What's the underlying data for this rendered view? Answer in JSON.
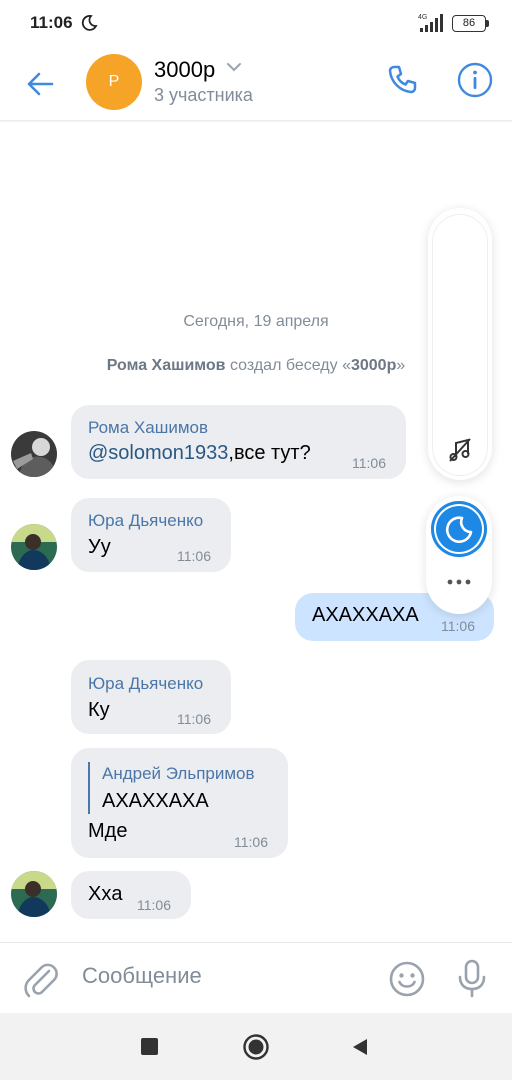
{
  "status_bar": {
    "time": "11:06",
    "battery": "86",
    "network": "4G"
  },
  "header": {
    "avatar_letter": "Р",
    "title": "3000р",
    "subtitle": "3 участника"
  },
  "chat": {
    "date": "Сегодня, 19 апреля",
    "system": {
      "actor": "Рома Хашимов",
      "action": " создал беседу «",
      "name": "3000р",
      "end": "»"
    },
    "messages": [
      {
        "sender": "Рома Хашимов",
        "mention": "@solomon1933",
        "text": ",все тут?",
        "time": "11:06"
      },
      {
        "sender": "Юра Дьяченко",
        "text": "Уу",
        "time": "11:06"
      },
      {
        "text": "АХАХХАХА",
        "time": "11:06",
        "outgoing": true
      },
      {
        "sender": "Юра Дьяченко",
        "text": "Ку",
        "time": "11:06"
      },
      {
        "sender": "Андрей Эльпримов",
        "quote": "АХАХХАХА",
        "text": "Мде",
        "time": "11:06"
      },
      {
        "text": "Ххa",
        "time": "11:06"
      }
    ]
  },
  "composer": {
    "placeholder": "Сообщение"
  },
  "colors": {
    "accent": "#4a76a8",
    "bubble_in": "#ebedf0",
    "bubble_out": "#cce4ff",
    "avatar_chat": "#f5a428"
  }
}
